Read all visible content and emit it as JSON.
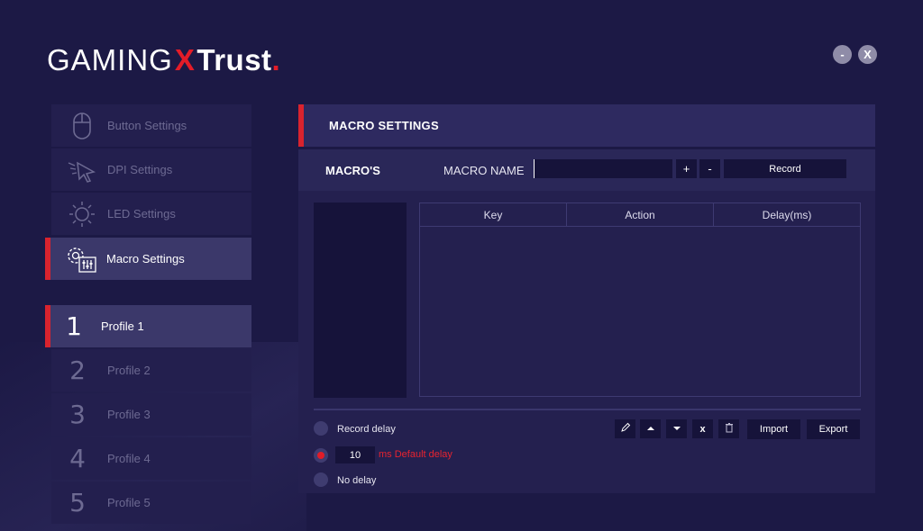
{
  "brand": {
    "part1": "GAMING",
    "part2": "X",
    "part3": "Trust",
    "part4": "."
  },
  "window": {
    "minimize_label": "-",
    "close_label": "X"
  },
  "menu": [
    {
      "label": "Button Settings",
      "icon": "mouse-icon"
    },
    {
      "label": "DPI Settings",
      "icon": "cursor-icon"
    },
    {
      "label": "LED Settings",
      "icon": "sun-icon"
    },
    {
      "label": "Macro Settings",
      "icon": "macro-gear-icon",
      "active": true
    }
  ],
  "profiles": [
    {
      "number": "1",
      "label": "Profile 1",
      "active": true
    },
    {
      "number": "2",
      "label": "Profile 2"
    },
    {
      "number": "3",
      "label": "Profile 3"
    },
    {
      "number": "4",
      "label": "Profile 4"
    },
    {
      "number": "5",
      "label": "Profile 5"
    }
  ],
  "panel": {
    "title": "MACRO SETTINGS",
    "macros_label": "MACRO'S",
    "macro_name_label": "MACRO NAME",
    "macro_name_value": "",
    "plus_label": "+",
    "minus_label": "-",
    "record_label": "Record"
  },
  "table": {
    "columns": [
      "Key",
      "Action",
      "Delay(ms)"
    ],
    "rows": []
  },
  "options": {
    "record_delay_label": "Record delay",
    "default_delay_value": "10",
    "default_delay_label": "ms Default delay",
    "no_delay_label": "No delay",
    "selected": "default_delay"
  },
  "tools": {
    "x_label": "x",
    "import_label": "Import",
    "export_label": "Export"
  },
  "colors": {
    "accent": "#d9232e",
    "background": "#1c1945",
    "panel": "#2e2a60"
  }
}
